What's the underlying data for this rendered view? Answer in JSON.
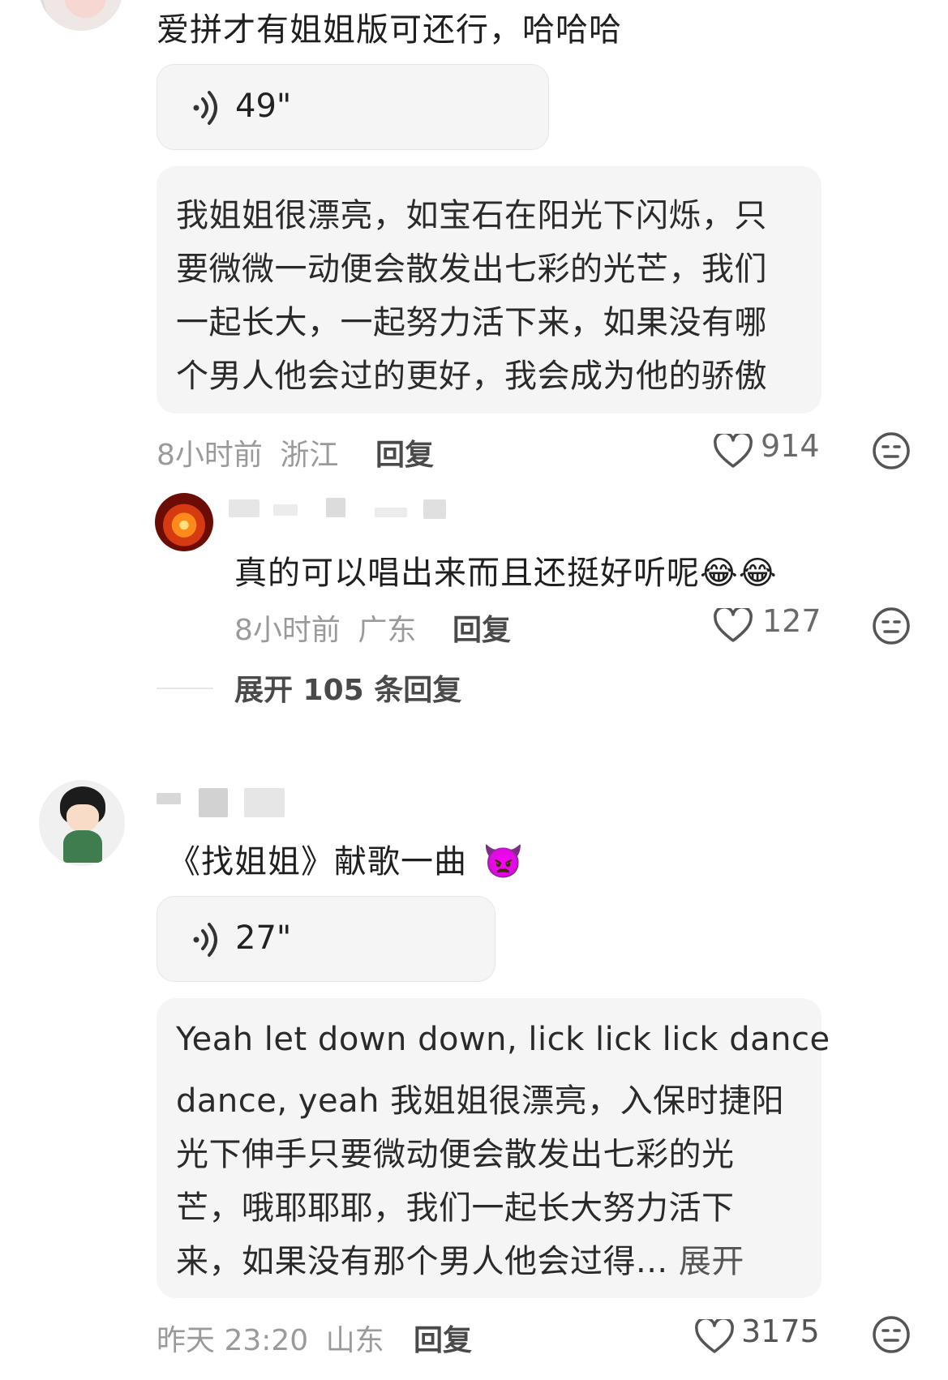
{
  "comment1": {
    "text": "爱拼才有姐姐版可还行，哈哈哈",
    "voice_duration": "49\"",
    "transcript_lines": [
      "我姐姐很漂亮，如宝石在阳光下闪烁，只",
      "要微微一动便会散发出七彩的光芒，我们",
      "一起长大，一起努力活下来，如果没有哪",
      "个男人他会过的更好，我会成为他的骄傲"
    ],
    "time": "8小时前",
    "location": "浙江",
    "reply_label": "回复",
    "likes": "914"
  },
  "reply1": {
    "text": "真的可以唱出来而且还挺好听呢",
    "emoji": "😂😂",
    "time": "8小时前",
    "location": "广东",
    "reply_label": "回复",
    "likes": "127"
  },
  "expand_replies": "展开 105 条回复",
  "comment2": {
    "text": "《找姐姐》献歌一曲",
    "emoji": "👿",
    "voice_duration": "27\"",
    "transcript_lines": [
      "Yeah let down down, lick lick lick dance",
      "dance, yeah 我姐姐很漂亮，入保时捷阳",
      "光下伸手只要微动便会散发出七彩的光",
      "芒，哦耶耶耶，我们一起长大努力活下",
      "来，如果没有那个男人他会过得..."
    ],
    "expand_label": "展开",
    "time": "昨天 23:20",
    "location": "山东",
    "reply_label": "回复",
    "likes": "3175"
  },
  "icons": {
    "voice": "sound-wave-icon",
    "like": "heart-icon",
    "dislike": "neutral-face-icon"
  },
  "colors": {
    "meta_gray": "#9a9a9a",
    "bubble_bg": "#f5f5f5"
  }
}
